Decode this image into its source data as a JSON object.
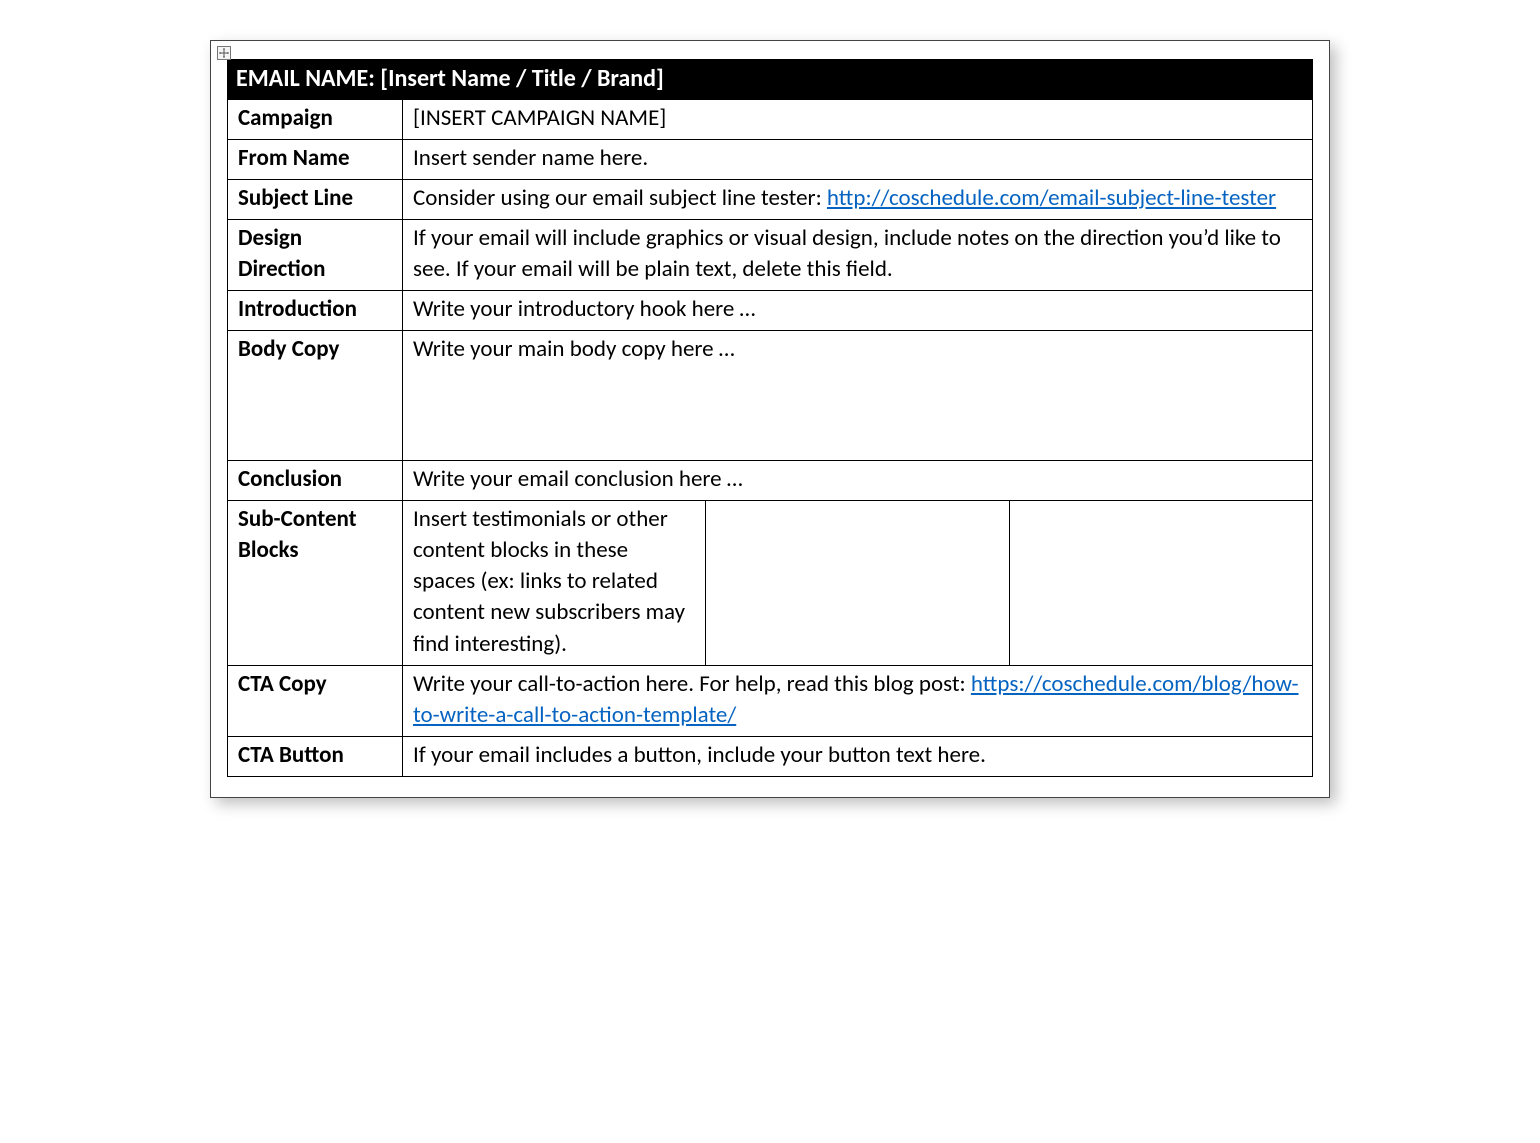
{
  "header": {
    "prefix": "EMAIL NAME:",
    "value": "[Insert Name / Title / Brand]"
  },
  "rows": {
    "campaign": {
      "label": "Campaign",
      "value": "[INSERT CAMPAIGN NAME]"
    },
    "from_name": {
      "label": "From Name",
      "value": "Insert sender name here."
    },
    "subject_line": {
      "label": "Subject Line",
      "text_before": "Consider using our email subject line tester: ",
      "link_text": "http://coschedule.com/email-subject-line-tester",
      "link_href": "http://coschedule.com/email-subject-line-tester"
    },
    "design_direction": {
      "label": "Design Direction",
      "value": "If your email will include graphics or visual design, include notes on the direction you’d like to see. If your email will be plain text, delete this field."
    },
    "introduction": {
      "label": "Introduction",
      "value": "Write your introductory hook here …"
    },
    "body_copy": {
      "label": "Body Copy",
      "value": "Write your main body copy here …"
    },
    "conclusion": {
      "label": "Conclusion",
      "value": "Write your email conclusion here …"
    },
    "sub_content": {
      "label": "Sub-Content Blocks",
      "col1": "Insert testimonials or other content blocks in these spaces (ex: links to related content new subscribers may find interesting).",
      "col2": "",
      "col3": ""
    },
    "cta_copy": {
      "label": "CTA Copy",
      "text_before": "Write your call-to-action here. For help, read this blog post: ",
      "link_text": "https://coschedule.com/blog/how-to-write-a-call-to-action-template/",
      "link_href": "https://coschedule.com/blog/how-to-write-a-call-to-action-template/"
    },
    "cta_button": {
      "label": "CTA Button",
      "value": "If your email includes a button, include your button text here."
    }
  }
}
